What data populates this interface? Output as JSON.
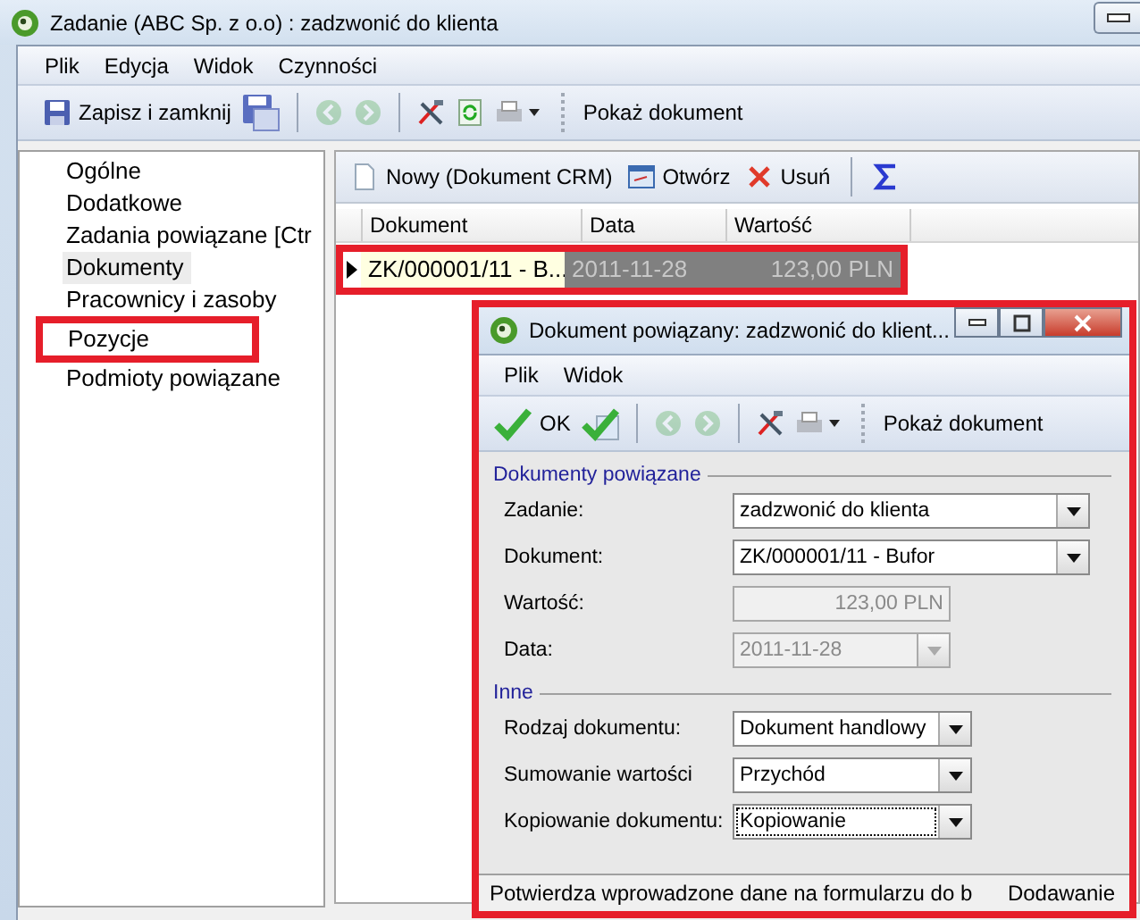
{
  "window": {
    "title": "Zadanie (ABC Sp. z o.o) : zadzwonić do klienta"
  },
  "menu": [
    "Plik",
    "Edycja",
    "Widok",
    "Czynności"
  ],
  "toolbar": {
    "save_close": "Zapisz i zamknij",
    "back_disabled": true,
    "forward_disabled": true,
    "show_document": "Pokaż dokument"
  },
  "sidebar": {
    "items": [
      {
        "label": "Ogólne",
        "selected": false,
        "highlighted": false
      },
      {
        "label": "Dodatkowe",
        "selected": false,
        "highlighted": false
      },
      {
        "label": "Zadania powiązane [Ctr",
        "selected": false,
        "highlighted": false
      },
      {
        "label": "Dokumenty",
        "selected": true,
        "highlighted": false
      },
      {
        "label": "Pracownicy i zasoby",
        "selected": false,
        "highlighted": false
      },
      {
        "label": "Pozycje",
        "selected": false,
        "highlighted": true
      },
      {
        "label": "Podmioty powiązane",
        "selected": false,
        "highlighted": false
      }
    ]
  },
  "documents": {
    "toolbar": {
      "new": "Nowy (Dokument CRM)",
      "open": "Otwórz",
      "delete": "Usuń"
    },
    "columns": [
      "Dokument",
      "Data",
      "Wartość"
    ],
    "rows": [
      {
        "cells": [
          "ZK/000001/11 - B...",
          "2011-11-28",
          "123,00 PLN"
        ],
        "current": true,
        "highlighted": true
      }
    ]
  },
  "dialog": {
    "title": "Dokument powiązany: zadzwonić do klient...",
    "highlighted": true,
    "menu": [
      "Plik",
      "Widok"
    ],
    "toolbar": {
      "ok": "OK",
      "back_disabled": true,
      "forward_disabled": true,
      "show_document": "Pokaż dokument"
    },
    "groups": [
      {
        "title": "Dokumenty powiązane",
        "fields": [
          {
            "label": "Zadanie:",
            "value": "zadzwonić do klienta",
            "kind": "lookup",
            "disabled": false,
            "focused": false
          },
          {
            "label": "Dokument:",
            "value": "ZK/000001/11 - Bufor",
            "kind": "lookup",
            "disabled": false,
            "focused": false
          },
          {
            "label": "Wartość:",
            "value": "123,00 PLN",
            "kind": "text",
            "disabled": true,
            "focused": false
          },
          {
            "label": "Data:",
            "value": "2011-11-28",
            "kind": "date",
            "disabled": true,
            "focused": false
          }
        ]
      },
      {
        "title": "Inne",
        "fields": [
          {
            "label": "Rodzaj dokumentu:",
            "value": "Dokument handlowy",
            "kind": "choice",
            "disabled": false,
            "focused": false
          },
          {
            "label": "Sumowanie wartości",
            "value": "Przychód",
            "kind": "choice",
            "disabled": false,
            "focused": false
          },
          {
            "label": "Kopiowanie dokumentu:",
            "value": "Kopiowanie",
            "kind": "choice",
            "disabled": false,
            "focused": true
          }
        ]
      }
    ],
    "status_bar": {
      "hint": "Potwierdza wprowadzone dane na formularzu do b",
      "mode": "Dodawanie"
    }
  }
}
